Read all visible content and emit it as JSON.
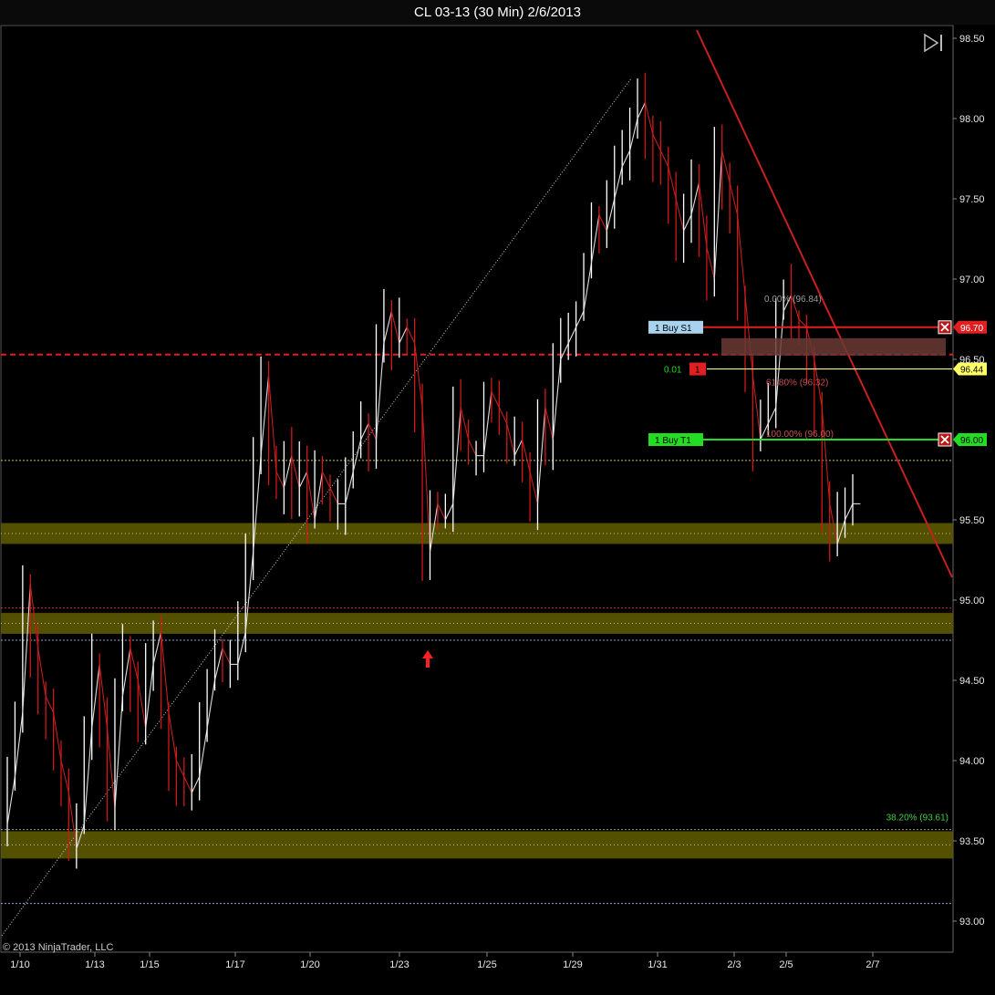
{
  "window": {
    "title": "CL 03-13 (30 Min)  2/6/2013"
  },
  "copyright": "© 2013 NinjaTrader, LLC",
  "colors": {
    "background": "#000000",
    "up_bar": "#ffffff",
    "down_bar": "#d01818",
    "zone_fill": "#5c5a00",
    "stop_line": "#e02020",
    "target_line": "#22dd22",
    "trendline": "#c82020",
    "current_price": "#ffff66"
  },
  "chart_data": {
    "type": "line",
    "instrument": "CL 03-13",
    "interval": "30 Min",
    "date": "2/6/2013",
    "ylim": [
      92.8,
      98.55
    ],
    "y_ticks": [
      "98.50",
      "98.00",
      "97.50",
      "97.00",
      "96.50",
      "95.50",
      "95.00",
      "94.50",
      "94.00",
      "93.50",
      "93.00"
    ],
    "x_ticks": [
      "1/10",
      "1/13",
      "1/15",
      "1/17",
      "1/20",
      "1/23",
      "1/25",
      "1/29",
      "1/31",
      "2/3",
      "2/5",
      "2/7"
    ],
    "series": [
      {
        "values": [
          93.6,
          93.9,
          94.3,
          95.1,
          94.7,
          94.4,
          94.3,
          94.0,
          93.8,
          93.45,
          93.6,
          94.2,
          94.6,
          94.2,
          93.7,
          94.4,
          94.7,
          94.5,
          94.2,
          94.6,
          94.8,
          94.3,
          94.0,
          93.9,
          93.8,
          93.9,
          94.2,
          94.5,
          94.7,
          94.6,
          94.6,
          94.8,
          95.3,
          95.9,
          96.4,
          95.8,
          95.7,
          95.9,
          95.7,
          95.8,
          95.5,
          95.8,
          95.7,
          95.6,
          95.6,
          95.8,
          96.0,
          96.1,
          96.0,
          96.6,
          96.8,
          96.6,
          96.7,
          96.6,
          96.2,
          95.3,
          95.6,
          95.5,
          95.6,
          96.2,
          96.0,
          95.9,
          95.9,
          96.3,
          96.2,
          96.1,
          95.9,
          96.0,
          95.8,
          95.6,
          96.2,
          96.0,
          96.5,
          96.6,
          96.7,
          96.8,
          97.1,
          97.4,
          97.3,
          97.5,
          97.7,
          97.8,
          98.0,
          98.1,
          97.9,
          97.8,
          97.7,
          97.5,
          97.3,
          97.4,
          97.6,
          97.2,
          97.0,
          97.8,
          97.6,
          97.4,
          96.9,
          96.4,
          96.0,
          96.1,
          96.2,
          96.8,
          96.9,
          96.75,
          96.7,
          96.5,
          96.2,
          95.6,
          95.35,
          95.5,
          95.6
        ]
      }
    ],
    "annotations": {
      "support_zones": [
        [
          95.35,
          95.48
        ],
        [
          94.79,
          94.92
        ],
        [
          93.39,
          93.56
        ]
      ],
      "horizontal_lines": [
        {
          "price": 96.53,
          "color": "red-dashed"
        },
        {
          "price": 95.87,
          "color": "yellow-dotted"
        },
        {
          "price": 94.95,
          "color": "red-dotted"
        },
        {
          "price": 94.75,
          "color": "blue-dotted"
        },
        {
          "price": 93.57,
          "color": "gray-dotted"
        },
        {
          "price": 93.11,
          "color": "blue-dotted"
        }
      ],
      "trendline": {
        "color": "red"
      },
      "fib_labels": [
        {
          "text": "0.00% (96.84)",
          "price": 96.84
        },
        {
          "text": "61.80% (96.32)",
          "price": 96.32
        },
        {
          "text": "100.00% (96.00)",
          "price": 96.0
        },
        {
          "text": "38.20% (93.61)",
          "price": 93.61
        }
      ],
      "orders": [
        {
          "label": "1  Buy S1",
          "price": 96.7,
          "price_label": "96.70"
        },
        {
          "label": "1  Buy T1",
          "price": 96.0,
          "price_label": "96.00"
        }
      ],
      "position": {
        "pnl": "0.01",
        "qty": "1",
        "price": 96.44,
        "price_label": "96.44"
      }
    }
  }
}
